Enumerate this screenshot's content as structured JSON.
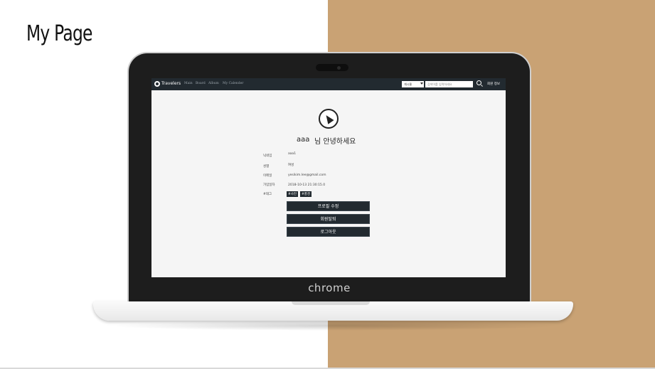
{
  "slide": {
    "title": "My Page"
  },
  "laptop": {
    "brand": "chrome"
  },
  "nav": {
    "brand": "Travelers",
    "links": [
      "Main",
      "Board",
      "Album",
      "My Calender"
    ],
    "select_value": "게시물",
    "search_placeholder": "검색어를 입력하세요",
    "member_label": "회원 정보"
  },
  "profile": {
    "username": "aaa",
    "greeting": "님 안녕하세요",
    "fields": [
      {
        "label": "닉네임",
        "value": "aaa1"
      },
      {
        "label": "성별",
        "value": "여성"
      },
      {
        "label": "이메일",
        "value": "yesikim.lee@gmail.com"
      },
      {
        "label": "가입일자",
        "value": "2018-10-13 21:30:15.0"
      },
      {
        "label": "#태그",
        "value": ""
      }
    ],
    "tags": [
      "#사진",
      "#풍경"
    ]
  },
  "buttons": {
    "edit_profile": "프로필 수정",
    "withdraw": "회원탈퇴",
    "logout": "로그아웃"
  },
  "colors": {
    "accent_bg": "#c9a274",
    "nav_bg": "#222a30"
  }
}
